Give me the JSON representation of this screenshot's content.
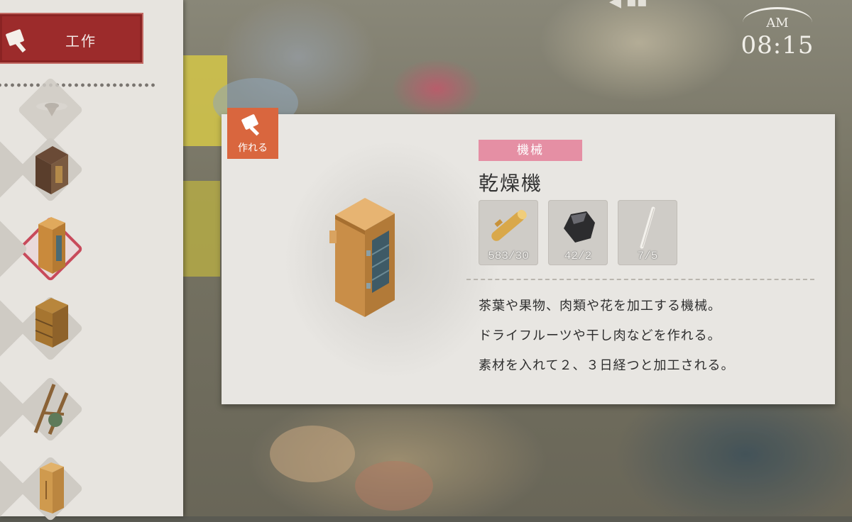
{
  "sidebar": {
    "tab_label": "工作",
    "items": [
      {
        "icon": "hat-icon"
      },
      {
        "icon": "storage-shed-icon"
      },
      {
        "icon": "dryer-icon",
        "selected": true
      },
      {
        "icon": "beehive-icon"
      },
      {
        "icon": "loom-icon"
      },
      {
        "icon": "cabinet-icon"
      }
    ]
  },
  "clock": {
    "ampm": "AM",
    "time": "08:15"
  },
  "detail": {
    "status_badge": "作れる",
    "category": "機械",
    "name": "乾燥機",
    "materials": [
      {
        "icon": "wood-log-icon",
        "count": "583/30"
      },
      {
        "icon": "coal-icon",
        "count": "42/2"
      },
      {
        "icon": "stick-icon",
        "count": "7/5"
      }
    ],
    "description": [
      "茶葉や果物、肉類や花を加工する機械。",
      "ドライフルーツや干し肉などを作れる。",
      "素材を入れて２、３日経つと加工される。"
    ]
  },
  "colors": {
    "tab": "#9c2b2b",
    "badge": "#d9663e",
    "category": "#e58fa4",
    "selection": "#c84a5b"
  }
}
